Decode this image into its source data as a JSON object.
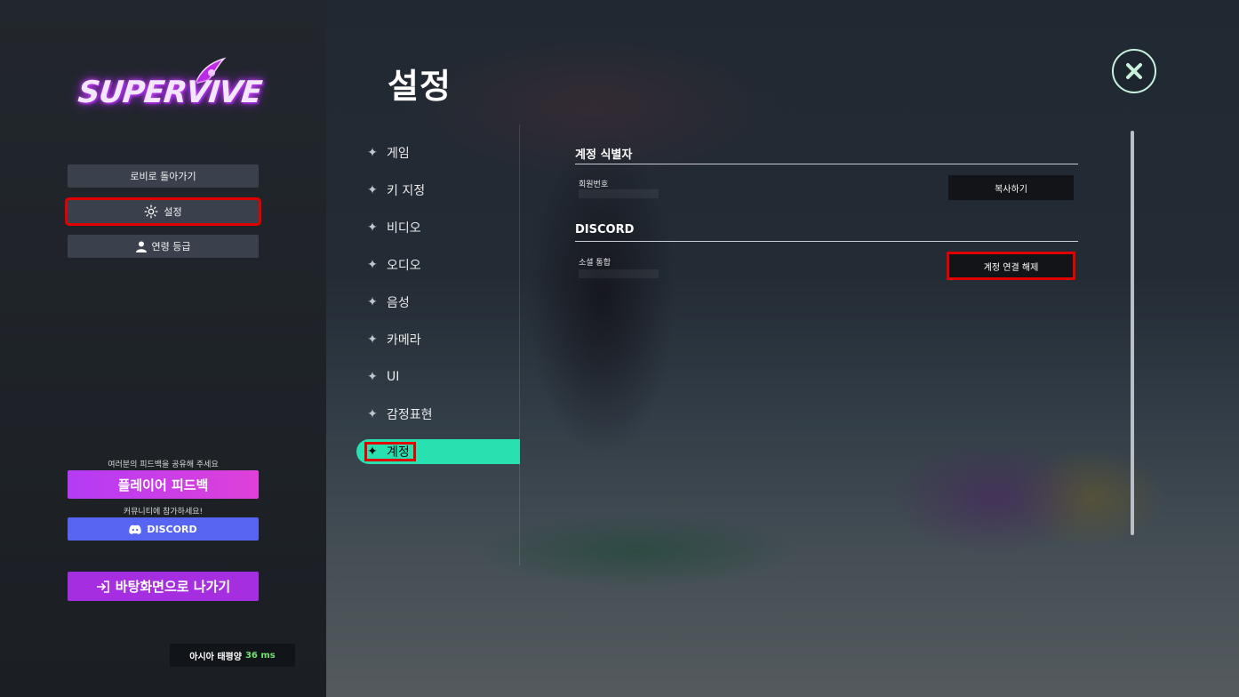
{
  "app": {
    "logo_text": "SUPERVIVE"
  },
  "left_menu": {
    "items": [
      {
        "label": "로비로 돌아가기"
      },
      {
        "label": "설정"
      },
      {
        "label": "연령 등급"
      }
    ],
    "feedback_caption": "여러분의 피드백을 공유해 주세요",
    "feedback_button": "플레이어 피드백",
    "community_caption": "커뮤니티에 참가하세요!",
    "discord_button": "DISCORD",
    "exit_button": "바탕화면으로 나가기",
    "server": {
      "region": "아시아 태평양",
      "ping": "36 ms"
    }
  },
  "settings": {
    "title": "설정",
    "nav": [
      {
        "label": "게임"
      },
      {
        "label": "키 지정"
      },
      {
        "label": "비디오"
      },
      {
        "label": "오디오"
      },
      {
        "label": "음성"
      },
      {
        "label": "카메라"
      },
      {
        "label": "UI"
      },
      {
        "label": "감정표현"
      },
      {
        "label": "계정"
      }
    ],
    "active_tab": "계정",
    "sections": {
      "account_id": {
        "title": "계정 식별자",
        "row_label": "회원번호",
        "button": "복사하기"
      },
      "discord": {
        "title": "DISCORD",
        "row_label": "소셜 통합",
        "button": "계정 연결 해제"
      }
    }
  },
  "colors": {
    "accent_teal": "#28e0b0",
    "feedback_purple": "#c03cf0",
    "discord_blue": "#5865f2",
    "exit_purple": "#a52ee0",
    "highlight_red": "#e00000",
    "ping_green": "#6fe36b"
  }
}
